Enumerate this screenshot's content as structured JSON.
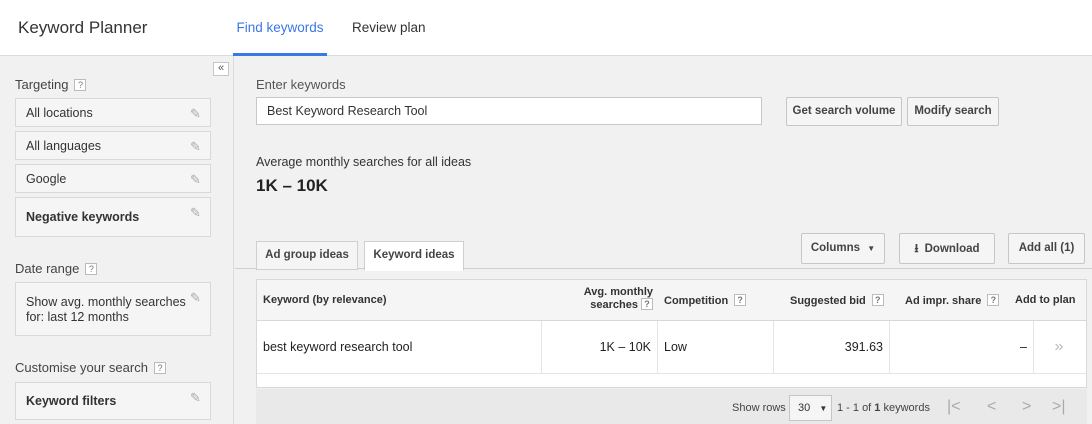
{
  "header": {
    "app_title": "Keyword Planner",
    "tabs": [
      {
        "label": "Find keywords"
      },
      {
        "label": "Review plan"
      }
    ]
  },
  "sidebar": {
    "collapse_glyph": "«",
    "targeting_title": "Targeting",
    "targeting_items": [
      {
        "label": "All locations"
      },
      {
        "label": "All languages"
      },
      {
        "label": "Google"
      },
      {
        "label": "Negative keywords"
      }
    ],
    "date_range_title": "Date range",
    "date_range_text_line1": "Show avg. monthly searches",
    "date_range_text_line2": "for: last 12 months",
    "customise_title": "Customise your search",
    "keyword_filters_label": "Keyword filters",
    "help_glyph": "?"
  },
  "main": {
    "enter_label": "Enter keywords",
    "keyword_value": "Best Keyword Research Tool",
    "get_volume_label": "Get search volume",
    "modify_label": "Modify search",
    "avg_label": "Average monthly searches for all ideas",
    "avg_value": "1K – 10K",
    "idea_tabs": [
      {
        "label": "Ad group ideas"
      },
      {
        "label": "Keyword ideas"
      }
    ],
    "columns_label": "Columns",
    "download_label": "Download",
    "add_all_label": "Add all (1)"
  },
  "table": {
    "headers": {
      "keyword": "Keyword (by relevance)",
      "avg_line1": "Avg. monthly",
      "avg_line2": "searches",
      "competition": "Competition",
      "bid": "Suggested bid",
      "share": "Ad impr. share",
      "add": "Add to plan"
    },
    "rows": [
      {
        "keyword": "best keyword research tool",
        "avg": "1K – 10K",
        "competition": "Low",
        "bid": "391.63",
        "share": "–",
        "add_glyph": "»"
      }
    ]
  },
  "pager": {
    "show_rows_label": "Show rows",
    "rows_value": "30",
    "range_prefix": "1 - 1 of ",
    "range_total": "1",
    "range_suffix": " keywords",
    "icons": [
      "|<",
      "<",
      ">",
      ">|"
    ]
  }
}
